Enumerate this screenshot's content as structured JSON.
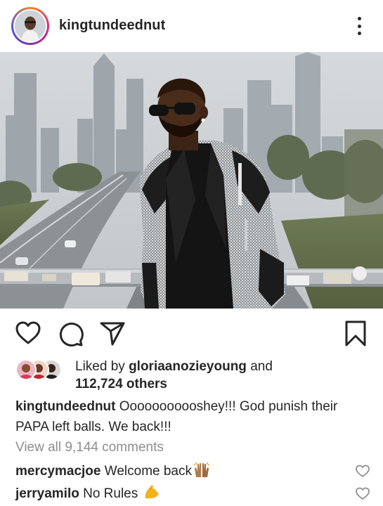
{
  "post": {
    "username": "kingtundeednut",
    "likes": {
      "prefix": "Liked by",
      "liker": "gloriaanozieyoung",
      "joiner": "and",
      "others": "112,724 others"
    },
    "caption": {
      "author": "kingtundeednut",
      "text": "Ooooooooooshey!!! God punish their PAPA left balls. We back!!!"
    },
    "view_comments": "View all 9,144 comments",
    "comments": [
      {
        "author": "mercymacjoe",
        "text": "Welcome back",
        "emoji": "raised-hands-emoji"
      },
      {
        "author": "jerryamilo",
        "text": "No Rules",
        "emoji": "flexed-biceps-emoji"
      }
    ]
  },
  "icons": {
    "like": "heart-icon",
    "comment": "speech-bubble-icon",
    "share": "paper-plane-icon",
    "save": "bookmark-icon",
    "more": "vertical-dots-icon"
  },
  "colors": {
    "text": "#262626",
    "muted": "#8e8e8e",
    "background": "#ffffff",
    "story_ring": "#dd2a7b"
  }
}
